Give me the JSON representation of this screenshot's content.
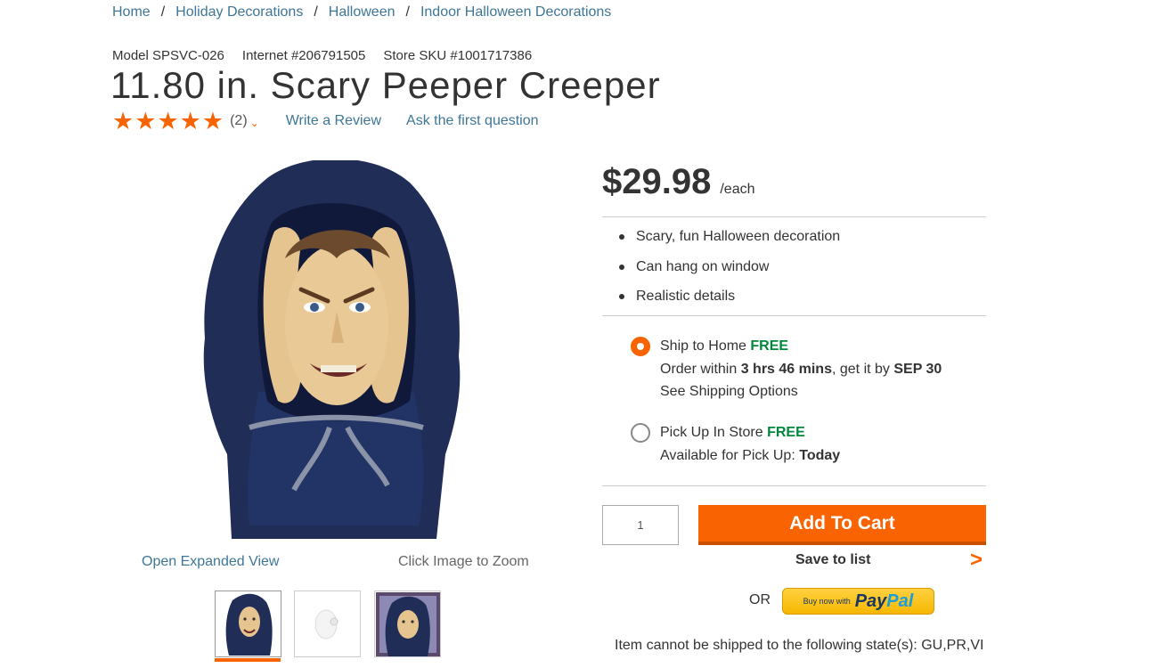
{
  "breadcrumb": {
    "items": [
      "Home",
      "Holiday Decorations",
      "Halloween",
      "Indoor Halloween Decorations"
    ],
    "separator": "/"
  },
  "product": {
    "model": "Model SPSVC-026",
    "internet": "Internet #206791505",
    "store_sku": "Store SKU #1001717386",
    "title": "11.80 in. Scary Peeper Creeper",
    "rating_stars": 5,
    "review_count": "(2)",
    "write_review": "Write a Review",
    "ask_question": "Ask the first question"
  },
  "gallery": {
    "expanded_view": "Open Expanded View",
    "zoom_hint": "Click Image to Zoom",
    "thumbnails": [
      "thumbnail-front",
      "thumbnail-suction-cup",
      "thumbnail-window"
    ],
    "selected_thumbnail": 0
  },
  "pricing": {
    "price": "$29.98",
    "unit": "/each"
  },
  "highlights": [
    "Scary, fun Halloween decoration",
    "Can hang on window",
    "Realistic details"
  ],
  "fulfillment": {
    "ship": {
      "label": "Ship to Home",
      "free": "FREE",
      "order_within_prefix": "Order within",
      "order_within_time": "3 hrs 46 mins",
      "get_it_by": ", get it by",
      "date": "SEP 30",
      "options_link": "See Shipping Options",
      "selected": true
    },
    "pickup": {
      "label": "Pick Up In Store",
      "free": "FREE",
      "available_prefix": "Available for Pick Up:",
      "available_when": "Today",
      "selected": false
    }
  },
  "cart": {
    "quantity": "1",
    "add_to_cart": "Add To Cart",
    "save_to_list": "Save to list",
    "or": "OR",
    "paypal_buy": "Buy now with",
    "paypal_pay": "Pay",
    "paypal_pal": "Pal",
    "shipping_restriction": "Item cannot be shipped to the following state(s): GU,PR,VI"
  },
  "colors": {
    "accent": "#f96302",
    "link": "#3e7697",
    "free": "#00873c",
    "hood": "#1f2d57",
    "skin": "#e6c48f"
  }
}
